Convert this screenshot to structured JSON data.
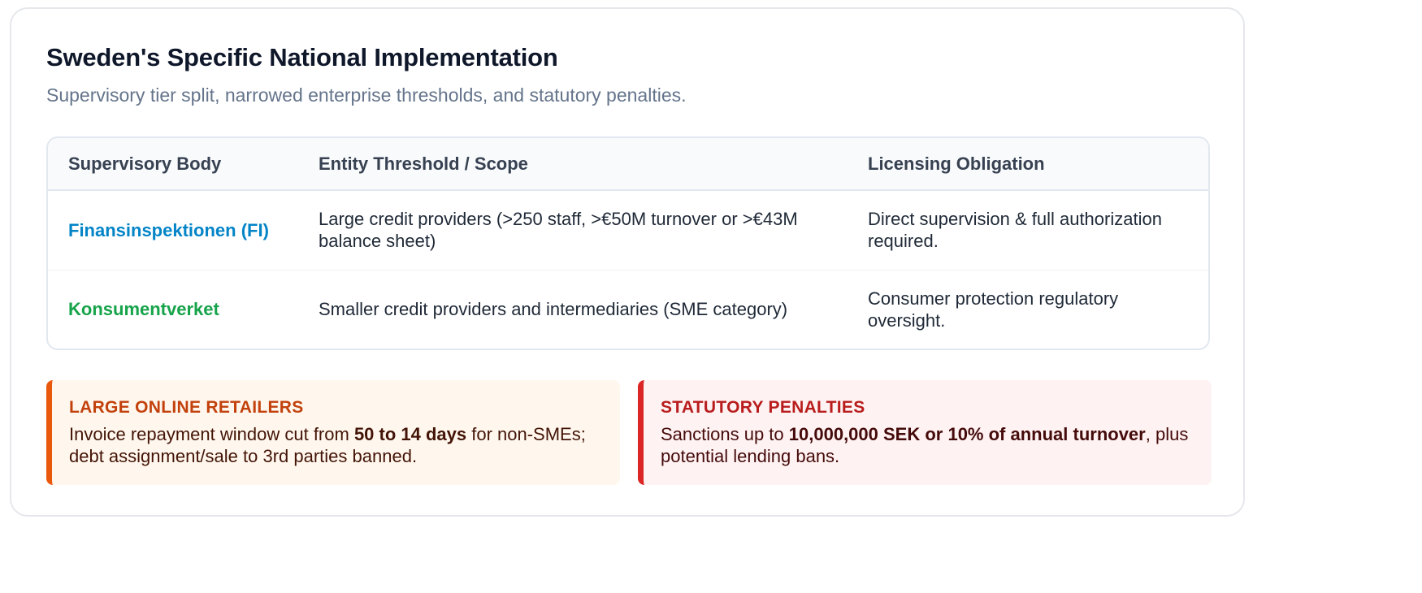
{
  "header": {
    "title": "Sweden's Specific National Implementation",
    "subtitle": "Supervisory tier split, narrowed enterprise thresholds, and statutory penalties."
  },
  "table": {
    "columns": [
      "Supervisory Body",
      "Entity Threshold / Scope",
      "Licensing Obligation"
    ],
    "rows": [
      {
        "body": "Finansinspektionen (FI)",
        "body_color": "#0284c7",
        "scope": "Large credit providers (>250 staff, >€50M turnover or >€43M balance sheet)",
        "obligation": "Direct supervision & full authorization required."
      },
      {
        "body": "Konsumentverket",
        "body_color": "#16a34a",
        "scope": "Smaller credit providers and intermediaries (SME category)",
        "obligation": "Consumer protection regulatory oversight."
      }
    ]
  },
  "notes": {
    "retailers": {
      "heading": "LARGE ONLINE RETAILERS",
      "text_before": "Invoice repayment window cut from ",
      "text_bold": "50 to 14 days",
      "text_after": " for non-SMEs; debt assignment/sale to 3rd parties banned.",
      "accent": "#ea580c"
    },
    "penalties": {
      "heading": "STATUTORY PENALTIES",
      "text_before": "Sanctions up to ",
      "text_bold": "10,000,000 SEK or 10% of annual turnover",
      "text_after": ", plus potential lending bans.",
      "accent": "#dc2626"
    }
  }
}
